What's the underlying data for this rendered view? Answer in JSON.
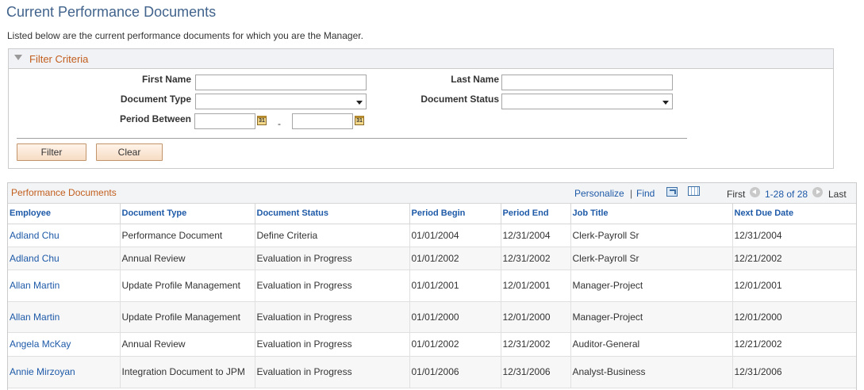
{
  "page": {
    "title": "Current Performance Documents",
    "intro": "Listed below are the current performance documents for which you are the Manager."
  },
  "filter": {
    "title": "Filter Criteria",
    "first_name_label": "First Name",
    "first_name_value": "",
    "last_name_label": "Last Name",
    "last_name_value": "",
    "document_type_label": "Document Type",
    "document_type_value": "",
    "document_status_label": "Document Status",
    "document_status_value": "",
    "period_between_label": "Period Between",
    "period_from_value": "",
    "period_to_value": "",
    "period_separator": "-",
    "calendar_glyph": "31",
    "filter_button": "Filter",
    "clear_button": "Clear"
  },
  "grid": {
    "title": "Performance Documents",
    "personalize": "Personalize",
    "separator": "|",
    "find": "Find",
    "first": "First",
    "range": "1-28 of 28",
    "last": "Last",
    "columns": [
      "Employee",
      "Document Type",
      "Document Status",
      "Period Begin",
      "Period End",
      "Job Title",
      "Next Due Date"
    ],
    "rows": [
      [
        "Adland Chu",
        "Performance Document",
        "Define Criteria",
        "01/01/2004",
        "12/31/2004",
        "Clerk-Payroll Sr",
        "12/31/2004"
      ],
      [
        "Adland Chu",
        "Annual Review",
        "Evaluation in Progress",
        "01/01/2002",
        "12/31/2002",
        "Clerk-Payroll Sr",
        "12/21/2002"
      ],
      [
        "Allan Martin",
        "Update Profile Management",
        "Evaluation in Progress",
        "01/01/2001",
        "12/01/2001",
        "Manager-Project",
        "12/01/2001"
      ],
      [
        "Allan Martin",
        "Update Profile Management",
        "Evaluation in Progress",
        "01/01/2000",
        "12/01/2000",
        "Manager-Project",
        "12/01/2000"
      ],
      [
        "Angela McKay",
        "Annual Review",
        "Evaluation in Progress",
        "01/01/2002",
        "12/31/2002",
        "Auditor-General",
        "12/21/2002"
      ],
      [
        "Annie Mirzoyan",
        "Integration Document to JPM",
        "Evaluation in Progress",
        "01/01/2006",
        "12/31/2006",
        "Analyst-Business",
        "12/31/2006"
      ]
    ]
  },
  "colors": {
    "title_blue": "#41638c",
    "link_blue": "#1e5aa8",
    "section_orange": "#c25e1e"
  },
  "icons": [
    "collapse-triangle-icon",
    "calendar-icon",
    "dropdown-caret-icon",
    "zoom-icon",
    "download-grid-icon",
    "previous-arrow-icon",
    "next-arrow-icon"
  ]
}
